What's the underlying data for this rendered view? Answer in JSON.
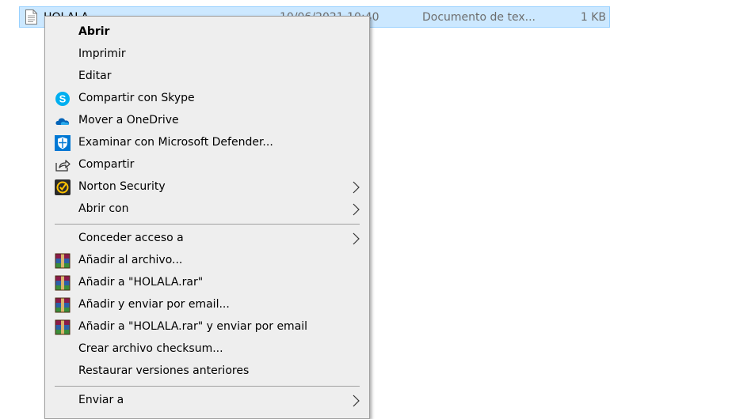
{
  "file_row": {
    "name": "HOLALA",
    "date": "10/06/2021 10:40",
    "type": "Documento de tex...",
    "size": "1 KB",
    "icon": "text-file-icon"
  },
  "context_menu": {
    "items": [
      {
        "label": "Abrir",
        "icon": null,
        "submenu": false,
        "default": true
      },
      {
        "label": "Imprimir",
        "icon": null,
        "submenu": false
      },
      {
        "label": "Editar",
        "icon": null,
        "submenu": false
      },
      {
        "label": "Compartir con Skype",
        "icon": "skype-icon",
        "submenu": false
      },
      {
        "label": "Mover a OneDrive",
        "icon": "onedrive-icon",
        "submenu": false
      },
      {
        "label": "Examinar con Microsoft Defender...",
        "icon": "defender-shield-icon",
        "submenu": false
      },
      {
        "label": "Compartir",
        "icon": "share-icon",
        "submenu": false
      },
      {
        "label": "Norton Security",
        "icon": "norton-icon",
        "submenu": true
      },
      {
        "label": "Abrir con",
        "icon": null,
        "submenu": true
      },
      {
        "label": "Conceder acceso a",
        "icon": null,
        "submenu": true
      },
      {
        "label": "Añadir al archivo...",
        "icon": "winrar-icon",
        "submenu": false
      },
      {
        "label": "Añadir a \"HOLALA.rar\"",
        "icon": "winrar-icon",
        "submenu": false
      },
      {
        "label": "Añadir y enviar por email...",
        "icon": "winrar-icon",
        "submenu": false
      },
      {
        "label": "Añadir a \"HOLALA.rar\" y enviar por email",
        "icon": "winrar-icon",
        "submenu": false
      },
      {
        "label": "Crear archivo checksum...",
        "icon": null,
        "submenu": false
      },
      {
        "label": "Restaurar versiones anteriores",
        "icon": null,
        "submenu": false
      },
      {
        "label": "Enviar a",
        "icon": null,
        "submenu": true
      }
    ]
  },
  "colors": {
    "selection_bg": "#cce8ff",
    "selection_border": "#99d1ff",
    "menu_bg": "#eeeeee",
    "menu_border": "#a0a0a0",
    "skype": "#00aff0",
    "onedrive": "#0364b8",
    "defender": "#0078d4",
    "norton": "#ffc300"
  }
}
